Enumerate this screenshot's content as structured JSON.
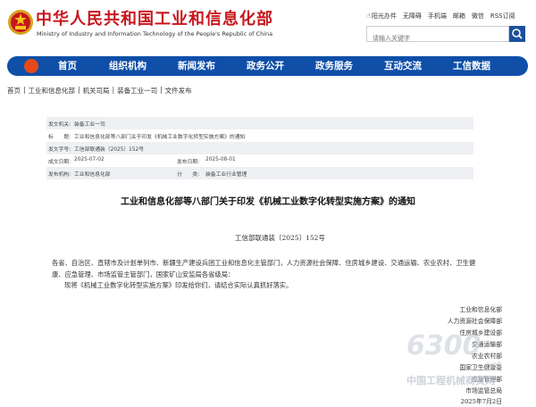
{
  "header": {
    "site_title": "中华人民共和国工业和信息化部",
    "site_subtitle": "Ministry of Industry and Information Technology of the People's Republic of China",
    "top_links": [
      "阳光办件",
      "无障碍",
      "手机端",
      "邮箱",
      "微信",
      "RSS订阅"
    ],
    "search_placeholder": "请输入关键字"
  },
  "nav": {
    "items": [
      "首页",
      "组织机构",
      "新闻发布",
      "政务公开",
      "政务服务",
      "互动交流",
      "工信数据"
    ]
  },
  "breadcrumb": [
    "首页",
    "工业和信息化部",
    "机关司局",
    "装备工业一司",
    "文件发布"
  ],
  "meta": {
    "rows": [
      {
        "label": "发文机关:",
        "value": "装备工业一司"
      },
      {
        "label": "标　　题:",
        "value": "工业和信息化部等八部门关于印发《机械工业数字化转型实施方案》的通知"
      },
      {
        "label": "发文字号:",
        "value": "工信部联通装〔2025〕152号"
      },
      {
        "label": "成文日期:",
        "value": "2025-07-02",
        "label2": "发布日期:",
        "value2": "2025-08-01"
      },
      {
        "label": "发布机构:",
        "value": "工业和信息化部",
        "label2": "分　　类:",
        "value2": "装备工业行业管理"
      }
    ]
  },
  "doc": {
    "title": "工业和信息化部等八部门关于印发《机械工业数字化转型实施方案》的通知",
    "number": "工信部联通装〔2025〕152号",
    "addressee": "各省、自治区、直辖市及计划单列市、新疆生产建设兵团工业和信息化主管部门，人力资源社会保障、住房城乡建设、交通运输、农业农村、卫生健康、应急管理、市场监管主管部门，国家矿山安监局各省级局：",
    "instruction": "现将《机械工业数字化转型实施方案》印发给你们，请结合实际认真抓好落实。",
    "signers": [
      "工业和信息化部",
      "人力资源社会保障部",
      "住房城乡建设部",
      "交通运输部",
      "农业农村部",
      "国家卫生健康委",
      "应急管理部",
      "市场监管总局"
    ],
    "date": "2025年7月2日"
  },
  "watermark": {
    "number": "6300",
    "net": ".net",
    "cn": "中国工程机械商贸网"
  },
  "colors": {
    "brand_red": "#c8161d",
    "nav_blue": "#0f4fa8",
    "search_blue": "#1c4f9c"
  }
}
